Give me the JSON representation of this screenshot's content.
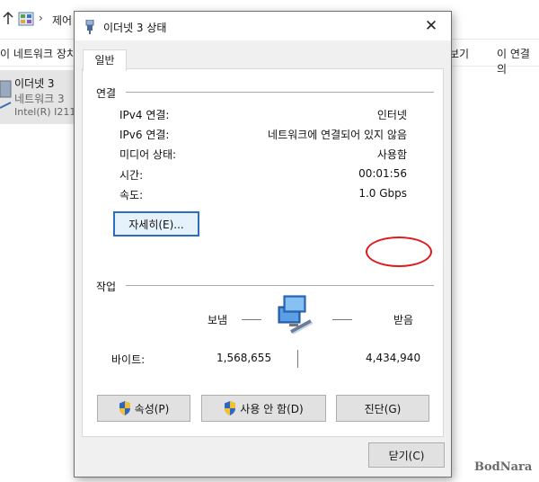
{
  "background": {
    "breadcrumb": "제어",
    "toolbar_left": "이 네트워크 장치",
    "toolbar_right_1": "보기",
    "toolbar_right_2": "이 연결의",
    "adapter": {
      "name": "이더넷 3",
      "status": "네트워크 3",
      "device": "Intel(R) I211"
    }
  },
  "dialog": {
    "title": "이더넷 3 상태",
    "tab": "일반",
    "connection": {
      "label": "연결",
      "rows": [
        {
          "label": "IPv4 연결:",
          "value": "인터넷"
        },
        {
          "label": "IPv6 연결:",
          "value": "네트워크에 연결되어 있지 않음"
        },
        {
          "label": "미디어 상태:",
          "value": "사용함"
        },
        {
          "label": "시간:",
          "value": "00:01:56"
        },
        {
          "label": "속도:",
          "value": "1.0 Gbps"
        }
      ],
      "details_button": "자세히(E)..."
    },
    "activity": {
      "label": "작업",
      "sent_label": "보냄",
      "received_label": "받음",
      "bytes_label": "바이트:",
      "bytes_sent": "1,568,655",
      "bytes_received": "4,434,940"
    },
    "buttons": {
      "properties": "속성(P)",
      "disable": "사용 안 함(D)",
      "diagnose": "진단(G)",
      "close": "닫기(C)"
    }
  },
  "watermark": "BodNara",
  "colors": {
    "highlight_ellipse": "#e0181a",
    "default_button_border": "#2a6ebf",
    "dialog_bg": "#f0f0f0"
  },
  "icons": {
    "up": "arrow-up-icon",
    "folder": "control-panel-icon",
    "title": "ethernet-plug-icon",
    "close": "close-icon",
    "shield": "uac-shield-icon",
    "network": "network-computer-icon"
  }
}
